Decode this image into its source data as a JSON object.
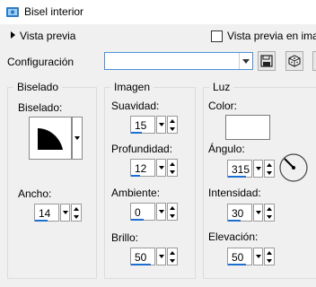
{
  "window": {
    "title": "Bisel interior"
  },
  "preview": {
    "expand_label": "Vista previa",
    "checkbox_label": "Vista previa en ima"
  },
  "config": {
    "label": "Configuración",
    "value": ""
  },
  "bevel": {
    "title": "Biselado",
    "shape_label": "Biselado:",
    "width_label": "Ancho:",
    "width_value": "14"
  },
  "image": {
    "title": "Imagen",
    "smoothness_label": "Suavidad:",
    "smoothness_value": "15",
    "depth_label": "Profundidad:",
    "depth_value": "12",
    "ambience_label": "Ambiente:",
    "ambience_value": "0",
    "brightness_label": "Brillo:",
    "brightness_value": "50"
  },
  "light": {
    "title": "Luz",
    "color_label": "Color:",
    "color_value": "#ffffff",
    "angle_label": "Ángulo:",
    "angle_value": "315",
    "intensity_label": "Intensidad:",
    "intensity_value": "30",
    "elevation_label": "Elevación:",
    "elevation_value": "50"
  }
}
